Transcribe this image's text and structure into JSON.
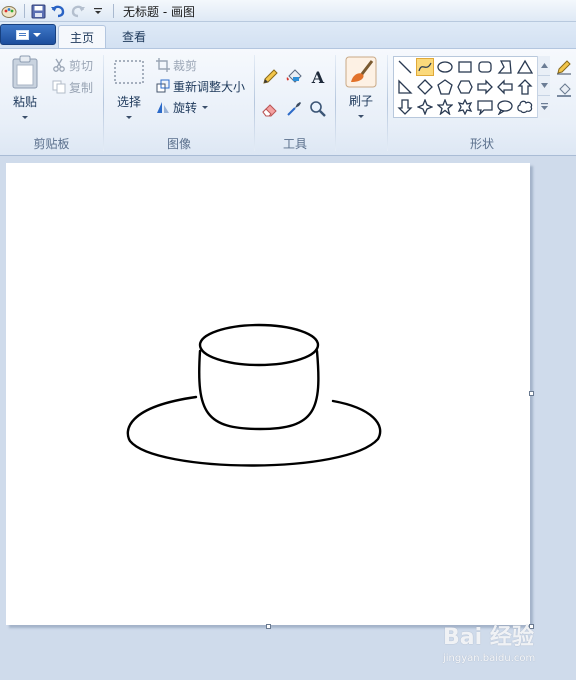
{
  "window": {
    "title": "无标题 - 画图"
  },
  "tabs": [
    {
      "label": "主页",
      "active": true
    },
    {
      "label": "查看",
      "active": false
    }
  ],
  "ribbon": {
    "clipboard": {
      "group_label": "剪贴板",
      "paste": "粘贴",
      "cut": "剪切",
      "copy": "复制"
    },
    "image": {
      "group_label": "图像",
      "select": "选择",
      "crop": "裁剪",
      "resize": "重新调整大小",
      "rotate": "旋转"
    },
    "tools": {
      "group_label": "工具",
      "text_tool_glyph": "A"
    },
    "brushes": {
      "label": "刷子"
    },
    "shapes": {
      "group_label": "形状",
      "selected_shape": "curve"
    }
  },
  "colors": {
    "accent": "#1c4e9d",
    "canvas": "#ffffff",
    "workspace": "#cfdbeb",
    "selected_shape_bg": "#fbd97b"
  },
  "watermark": {
    "main": "Bai 经验",
    "sub": "jingyan.baidu.com"
  }
}
